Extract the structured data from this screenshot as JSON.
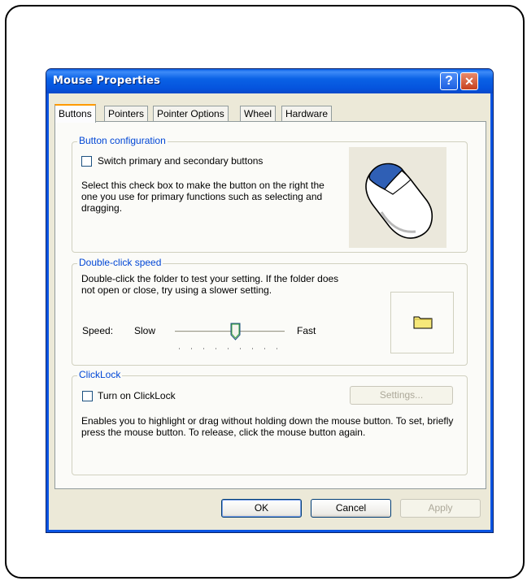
{
  "window": {
    "title": "Mouse Properties",
    "help_glyph": "?",
    "close_glyph": "✕"
  },
  "tabs": [
    {
      "label": "Buttons",
      "active": true
    },
    {
      "label": "Pointers",
      "active": false
    },
    {
      "label": "Pointer Options",
      "active": false
    },
    {
      "label": "Wheel",
      "active": false
    },
    {
      "label": "Hardware",
      "active": false
    }
  ],
  "button_config": {
    "title": "Button configuration",
    "checkbox_label": "Switch primary and secondary buttons",
    "checked": false,
    "description": "Select this check box to make the button on the right the one you use for primary functions such as selecting and dragging."
  },
  "double_click": {
    "title": "Double-click speed",
    "description": "Double-click the folder to test your setting. If the folder does not open or close, try using a slower setting.",
    "speed_label": "Speed:",
    "slow_label": "Slow",
    "fast_label": "Fast",
    "slider_value_fraction": 0.55
  },
  "clicklock": {
    "title": "ClickLock",
    "checkbox_label": "Turn on ClickLock",
    "checked": false,
    "settings_label": "Settings...",
    "settings_enabled": false,
    "description": "Enables you to highlight or drag without holding down the mouse button. To set, briefly press the mouse button. To release, click the mouse button again."
  },
  "footer": {
    "ok_label": "OK",
    "cancel_label": "Cancel",
    "apply_label": "Apply",
    "apply_enabled": false
  },
  "colors": {
    "titlebar": "#0553dd",
    "group_title": "#0046d5",
    "active_tab_accent": "#ff9a00",
    "dialog_bg": "#ece9d8"
  },
  "icons": {
    "mouse": "mouse-icon",
    "folder": "folder-icon"
  }
}
